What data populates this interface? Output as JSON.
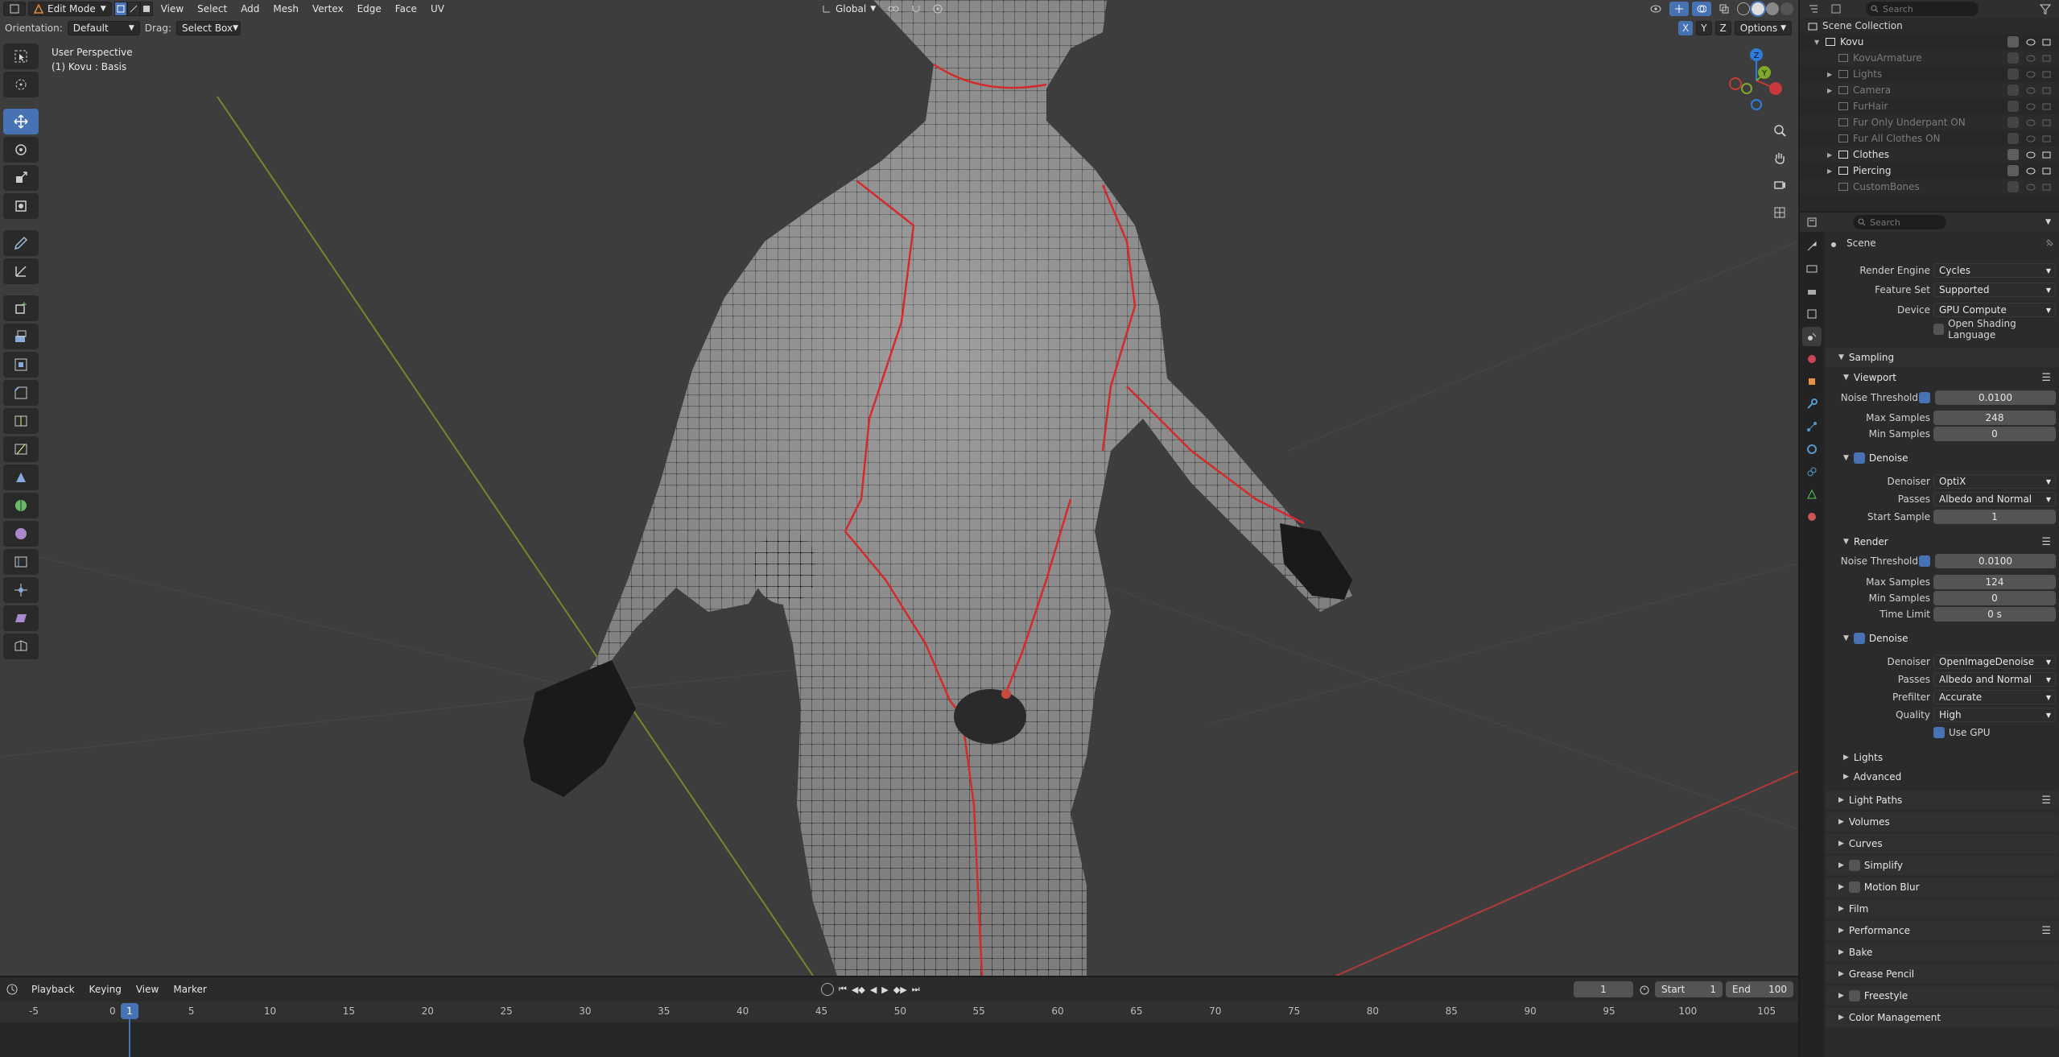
{
  "header": {
    "mode": "Edit Mode",
    "menus": [
      "View",
      "Select",
      "Add",
      "Mesh",
      "Vertex",
      "Edge",
      "Face",
      "UV"
    ],
    "transform_orientation": "Global",
    "options": "Options",
    "axis_x": "X",
    "axis_y": "Y",
    "axis_z": "Z",
    "orientation_label": "Orientation:",
    "orientation_value": "Default",
    "drag_label": "Drag:",
    "drag_value": "Select Box",
    "search_placeholder": "Search"
  },
  "viewport": {
    "perspective": "User Perspective",
    "object_info": "(1) Kovu : Basis"
  },
  "timeline": {
    "menus": [
      "Playback",
      "Keying",
      "View",
      "Marker"
    ],
    "current_frame": "1",
    "start_label": "Start",
    "start_value": "1",
    "end_label": "End",
    "end_value": "100",
    "ticks": [
      "-5",
      "0",
      "5",
      "10",
      "15",
      "20",
      "25",
      "30",
      "35",
      "40",
      "45",
      "50",
      "55",
      "60",
      "65",
      "70",
      "75",
      "80",
      "85",
      "90",
      "95",
      "100",
      "105"
    ],
    "cursor_label": "1"
  },
  "outliner": {
    "search_placeholder": "Search",
    "root": "Scene Collection",
    "items": [
      {
        "label": "Kovu",
        "dim": false
      },
      {
        "label": "KovuArmature",
        "dim": true
      },
      {
        "label": "Lights",
        "dim": true
      },
      {
        "label": "Camera",
        "dim": true
      },
      {
        "label": "FurHair",
        "dim": true
      },
      {
        "label": "Fur Only Underpant ON",
        "dim": true
      },
      {
        "label": "Fur All Clothes ON",
        "dim": true
      },
      {
        "label": "Clothes",
        "dim": false
      },
      {
        "label": "Piercing",
        "dim": false
      },
      {
        "label": "CustomBones",
        "dim": true
      }
    ]
  },
  "properties": {
    "search_placeholder": "Search",
    "context": "Scene",
    "render_engine_label": "Render Engine",
    "render_engine": "Cycles",
    "feature_set_label": "Feature Set",
    "feature_set": "Supported",
    "device_label": "Device",
    "device": "GPU Compute",
    "osl_label": "Open Shading Language",
    "sampling": "Sampling",
    "viewport_sub": "Viewport",
    "noise_threshold_label": "Noise Threshold",
    "vp_noise_threshold": "0.0100",
    "max_samples_label": "Max Samples",
    "vp_max_samples": "248",
    "min_samples_label": "Min Samples",
    "vp_min_samples": "0",
    "denoise": "Denoise",
    "denoiser_label": "Denoiser",
    "vp_denoiser": "OptiX",
    "passes_label": "Passes",
    "vp_passes": "Albedo and Normal",
    "start_sample_label": "Start Sample",
    "vp_start_sample": "1",
    "render_sub": "Render",
    "r_noise_threshold": "0.0100",
    "r_max_samples": "124",
    "r_min_samples": "0",
    "time_limit_label": "Time Limit",
    "r_time_limit": "0 s",
    "r_denoiser": "OpenImageDenoise",
    "r_passes": "Albedo and Normal",
    "prefilter_label": "Prefilter",
    "r_prefilter": "Accurate",
    "quality_label": "Quality",
    "r_quality": "High",
    "use_gpu": "Use GPU",
    "lights_sub": "Lights",
    "advanced_sub": "Advanced",
    "panels": [
      "Light Paths",
      "Volumes",
      "Curves",
      "Simplify",
      "Motion Blur",
      "Film",
      "Performance",
      "Bake",
      "Grease Pencil",
      "Freestyle",
      "Color Management"
    ]
  },
  "colors": {
    "accent": "#4772b3",
    "viewport_bg": "#3d3d3d",
    "seam_red": "#d42a2a",
    "x_axis": "#c9383a",
    "y_axis": "#7fa82a",
    "z_axis": "#2f7ddb"
  }
}
